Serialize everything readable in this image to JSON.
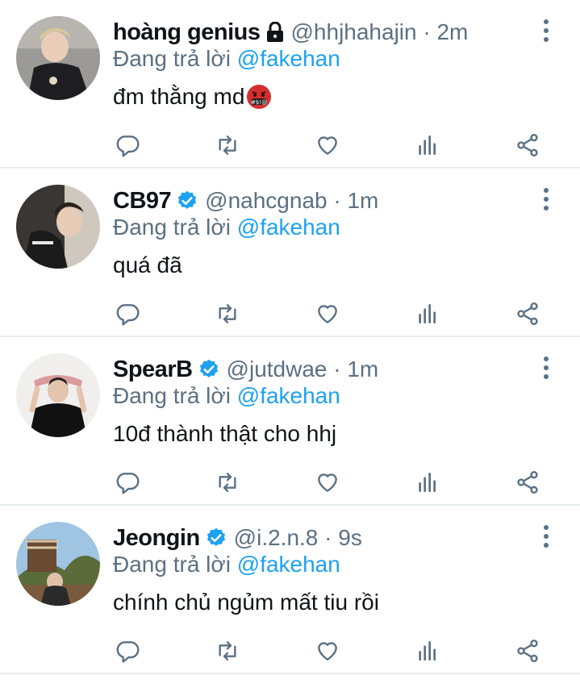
{
  "colors": {
    "link": "#1da1f2",
    "muted": "#5b7083",
    "text": "#0f1419",
    "verified": "#1da1f2"
  },
  "icons": [
    "lock-icon",
    "verified-badge-icon",
    "more-options-icon",
    "reply-icon",
    "retweet-icon",
    "like-icon",
    "analytics-icon",
    "share-icon",
    "angry-face-emoji"
  ],
  "tweets": [
    {
      "name": "hoàng genius",
      "handle": "@hhjhahajin · 2m",
      "reply_prefix": "Đang trả lời",
      "mention": "@fakehan",
      "text": "đm thằng md",
      "badge": "lock"
    },
    {
      "name": "CB97",
      "handle": "@nahcgnab · 1m",
      "reply_prefix": "Đang trả lời",
      "mention": "@fakehan",
      "text": "quá đã",
      "badge": "verified"
    },
    {
      "name": "SpearB",
      "handle": "@jutdwae · 1m",
      "reply_prefix": "Đang trả lời",
      "mention": "@fakehan",
      "text": "10đ thành thật cho hhj",
      "badge": "verified"
    },
    {
      "name": "Jeongin",
      "handle": "@i.2.n.8 · 9s",
      "reply_prefix": "Đang trả lời",
      "mention": "@fakehan",
      "text": "chính chủ ngủm mất tiu rồi",
      "badge": "verified"
    }
  ]
}
